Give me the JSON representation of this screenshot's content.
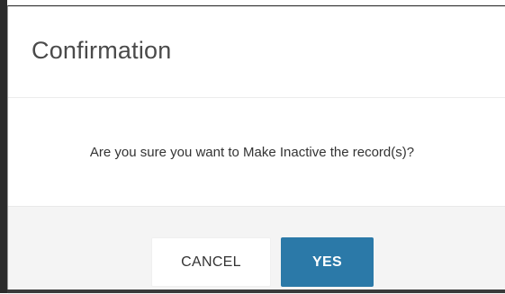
{
  "dialog": {
    "title": "Confirmation",
    "message": "Are you sure you want to Make Inactive the record(s)?",
    "buttons": {
      "cancel_label": "CANCEL",
      "yes_label": "YES"
    }
  },
  "colors": {
    "primary_button": "#2b79a8",
    "footer_background": "#f4f4f4"
  }
}
